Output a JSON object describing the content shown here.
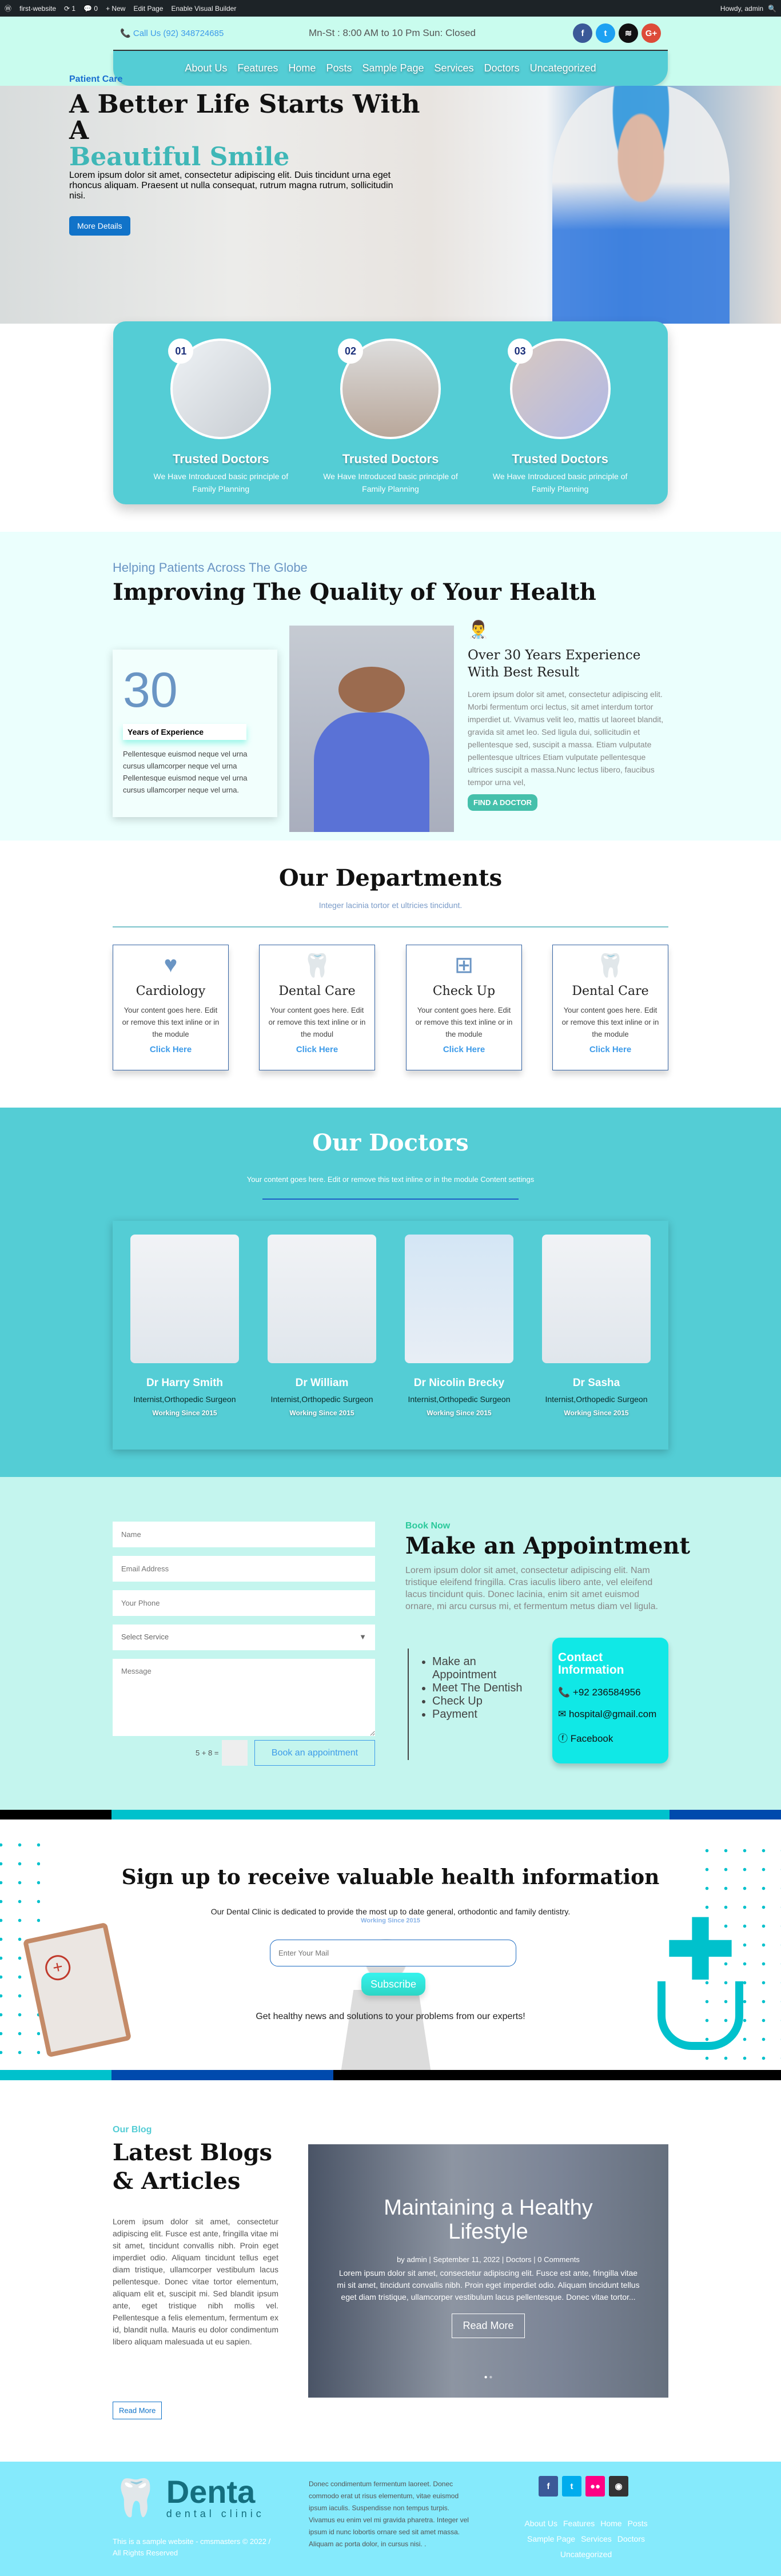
{
  "admin_bar": {
    "site": "first-website",
    "updates": "1",
    "comments": "0",
    "new": "New",
    "edit": "Edit Page",
    "builder": "Enable Visual Builder",
    "howdy": "Howdy, admin"
  },
  "header": {
    "phone": "Call Us (92) 348724685",
    "hours": "Mn-St : 8:00 AM to 10 Pm Sun: Closed",
    "social": [
      "facebook",
      "twitter",
      "buffer",
      "google-plus"
    ],
    "nav": [
      "About Us",
      "Features",
      "Home",
      "Posts",
      "Sample Page",
      "Services",
      "Doctors",
      "Uncategorized"
    ]
  },
  "hero": {
    "kicker": "Patient Care",
    "title_line1": "A Better Life Starts With A",
    "title_line2": "Beautiful Smile",
    "text": "Lorem ipsum dolor sit amet, consectetur adipiscing elit. Duis tincidunt urna eget rhoncus aliquam. Praesent ut nulla consequat, rutrum magna rutrum, sollicitudin nisi.",
    "button": "More Details"
  },
  "features": [
    {
      "num": "01",
      "title": "Trusted Doctors",
      "text": "We Have Introduced basic principle of Family Planning"
    },
    {
      "num": "02",
      "title": "Trusted Doctors",
      "text": "We Have Introduced basic principle of Family Planning"
    },
    {
      "num": "03",
      "title": "Trusted Doctors",
      "text": "We Have Introduced basic principle of Family Planning"
    }
  ],
  "quality": {
    "subtitle": "Helping Patients Across The Globe",
    "title": "Improving The Quality of Your Health",
    "counter": "30",
    "counter_label": "Years of Experience",
    "card_text": "Pellentesque euismod neque vel urna cursus ullamcorper neque vel urna Pellentesque euismod neque vel urna cursus ullamcorper neque vel urna.",
    "exp_title": "Over 30 Years Experience With Best Result",
    "exp_text": "Lorem ipsum dolor sit amet, consectetur adipiscing elit. Morbi fermentum orci lectus, sit amet interdum tortor imperdiet ut. Vivamus velit leo, mattis ut laoreet blandit, gravida sit amet leo. Sed ligula dui, sollicitudin et pellentesque sed, suscipit a massa. Etiam vulputate pellentesque ultrices Etiam vulputate pellentesque ultrices suscipit a massa.Nunc lectus libero, faucibus tempor urna vel,",
    "button": "FIND A DOCTOR"
  },
  "departments": {
    "title": "Our Departments",
    "subtitle": "Integer lacinia tortor et ultricies tincidunt.",
    "items": [
      {
        "icon": "heart-pulse",
        "title": "Cardiology",
        "text": "Your content goes here. Edit or remove this text inline or in the module",
        "link": "Click Here"
      },
      {
        "icon": "tooth",
        "title": "Dental Care",
        "text": "Your content goes here. Edit or remove this text inline or in the modul",
        "link": "Click Here"
      },
      {
        "icon": "medical-kit",
        "title": "Check Up",
        "text": "Your content goes here. Edit or remove this text inline or in the module",
        "link": "Click Here"
      },
      {
        "icon": "tooth",
        "title": "Dental Care",
        "text": "Your content goes here. Edit or remove this text inline or in the module",
        "link": "Click Here"
      }
    ]
  },
  "doctors": {
    "title": "Our Doctors",
    "subtitle": "Your content goes here. Edit or remove this text inline or in the module Content settings",
    "items": [
      {
        "name": "Dr Harry Smith",
        "role": "Internist,Orthopedic Surgeon",
        "since": "Working Since 2015"
      },
      {
        "name": "Dr William",
        "role": "Internist,Orthopedic Surgeon",
        "since": "Working Since 2015"
      },
      {
        "name": "Dr Nicolin Brecky",
        "role": "Internist,Orthopedic Surgeon",
        "since": "Working Since 2015"
      },
      {
        "name": "Dr Sasha",
        "role": "Internist,Orthopedic Surgeon",
        "since": "Working Since 2015"
      }
    ]
  },
  "appointment": {
    "form": {
      "name": "Name",
      "email": "Email Address",
      "phone": "Your Phone",
      "service": "Select Service",
      "message": "Message",
      "captcha": "5 + 8 =",
      "submit": "Book an appointment"
    },
    "kicker": "Book Now",
    "title": "Make an Appointment",
    "text": "Lorem ipsum dolor sit amet, consectetur adipiscing elit. Nam tristique eleifend fringilla. Cras iaculis libero ante, vel eleifend lacus tincidunt quis. Donec lacinia, enim sit amet euismod ornare, mi arcu cursus mi, et fermentum metus diam vel ligula.",
    "list": [
      "Make an Appointment",
      "Meet The Dentish",
      "Check Up",
      "Payment"
    ],
    "contact": {
      "title": "Contact Information",
      "phone": "+92 236584956",
      "email": "hospital@gmail.com",
      "facebook": "Facebook"
    }
  },
  "newsletter": {
    "title": "Sign up to receive valuable health information",
    "text": "Our Dental Clinic is dedicated to provide the most up to date general, orthodontic and family dentistry.",
    "overlay": "Working Since 2015",
    "placeholder": "Enter Your Mail",
    "button": "Subscribe",
    "footer_text": "Get healthy news and solutions to your problems from our experts!"
  },
  "blog": {
    "kicker": "Our Blog",
    "title": "Latest Blogs & Articles",
    "text": "Lorem ipsum dolor sit amet, consectetur adipiscing elit. Fusce est ante, fringilla vitae mi sit amet, tincidunt convallis nibh. Proin eget imperdiet odio. Aliquam tincidunt tellus eget diam tristique, ullamcorper vestibulum lacus pellentesque. Donec vitae tortor elementum, aliquam elit et, suscipit mi. Sed blandit ipsum ante, eget tristique nibh mollis vel. Pellentesque a felis elementum, fermentum ex id, blandit nulla. Mauris eu dolor condimentum libero aliquam malesuada ut eu sapien.",
    "button": "Read More",
    "slide": {
      "title": "Maintaining a Healthy Lifestyle",
      "meta": "by admin | September 11, 2022 | Doctors | 0 Comments",
      "excerpt": "Lorem ipsum dolor sit amet, consectetur adipiscing elit. Fusce est ante, fringilla vitae mi sit amet, tincidunt convallis nibh. Proin eget imperdiet odio. Aliquam tincidunt tellus eget diam tristique, ullamcorper vestibulum lacus pellentesque. Donec vitae tortor...",
      "button": "Read More"
    }
  },
  "footer": {
    "logo": "Denta",
    "logo_sub": "dental clinic",
    "copyright": "This is a sample website - cmsmasters © 2022 / All Rights Reserved",
    "text": "Donec condimentum fermentum laoreet. Donec commodo erat ut risus elementum, vitae euismod ipsum iaculis. Suspendisse non tempus turpis. Vivamus eu enim vel mi gravida pharetra. Integer vel ipsum id nunc lobortis ornare sed sit amet massa. Aliquam ac porta dolor, in cursus nisi. .",
    "social": [
      "facebook",
      "twitter",
      "flickr",
      "github"
    ],
    "nav": [
      "About Us",
      "Features",
      "Home",
      "Posts",
      "Sample Page",
      "Services",
      "Doctors",
      "Uncategorized"
    ]
  },
  "colors": {
    "teal": "#54cdd5",
    "mint": "#c4f5ee",
    "blue": "#1173c9",
    "footer": "#85eafc"
  }
}
